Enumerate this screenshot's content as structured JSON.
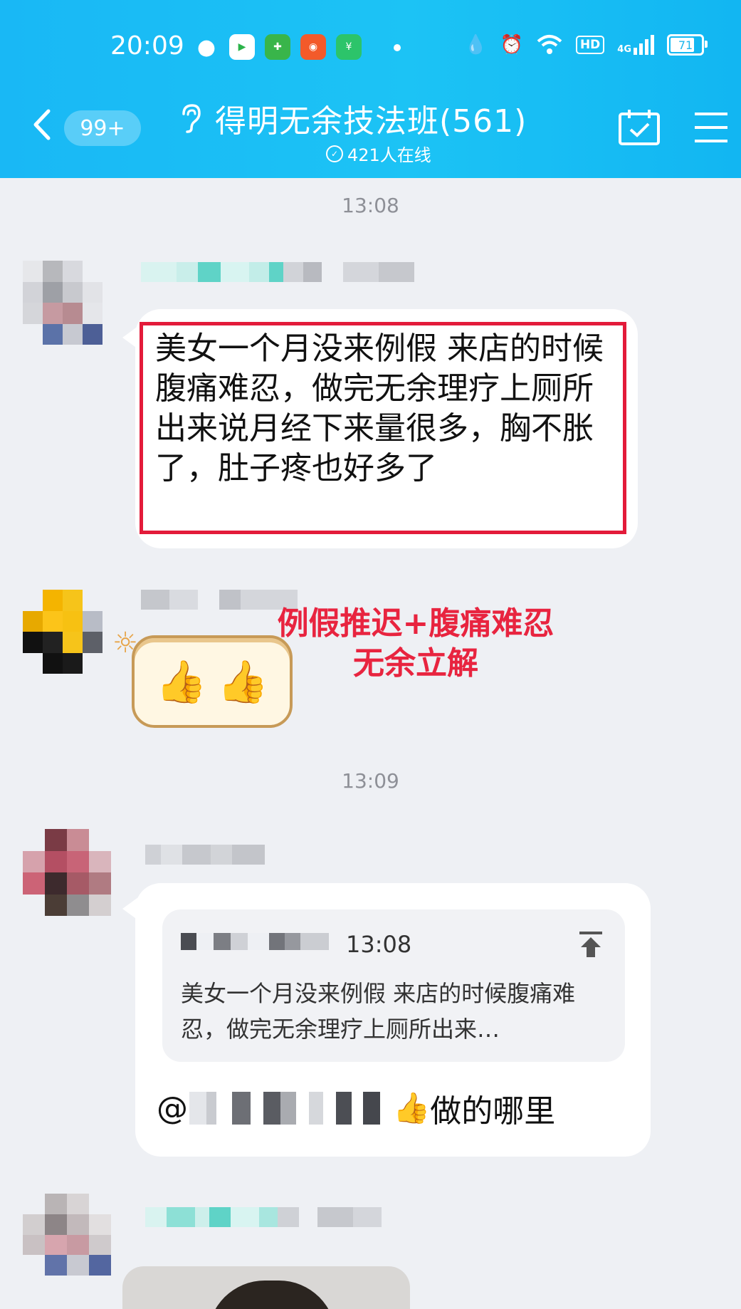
{
  "status_bar": {
    "time": "20:09",
    "hd_label": "HD",
    "network_label": "4G",
    "battery": "71"
  },
  "header": {
    "back_badge": "99+",
    "title": "得明无余技法班(561)",
    "online_count": "421人在线"
  },
  "messages": {
    "timestamp_1": "13:08",
    "msg1_text": "美女一个月没来例假  来店的时候腹痛难忍，做完无余理疗上厕所出来说月经下来量很多，胸不胀了，肚子疼也好多了",
    "caption_line1": "例假推迟+腹痛难忍",
    "caption_line2": "无余立解",
    "timestamp_2": "13:09",
    "quote_time": "13:08",
    "quote_text": "美女一个月没来例假  来店的时候腹痛难忍，做完无余理疗上厕所出来…",
    "reply_at": "@",
    "reply_text": "做的哪里"
  },
  "colors": {
    "header_blue": "#19b8f5",
    "highlight_red": "#e31b3a",
    "chat_background": "#eef0f4"
  }
}
